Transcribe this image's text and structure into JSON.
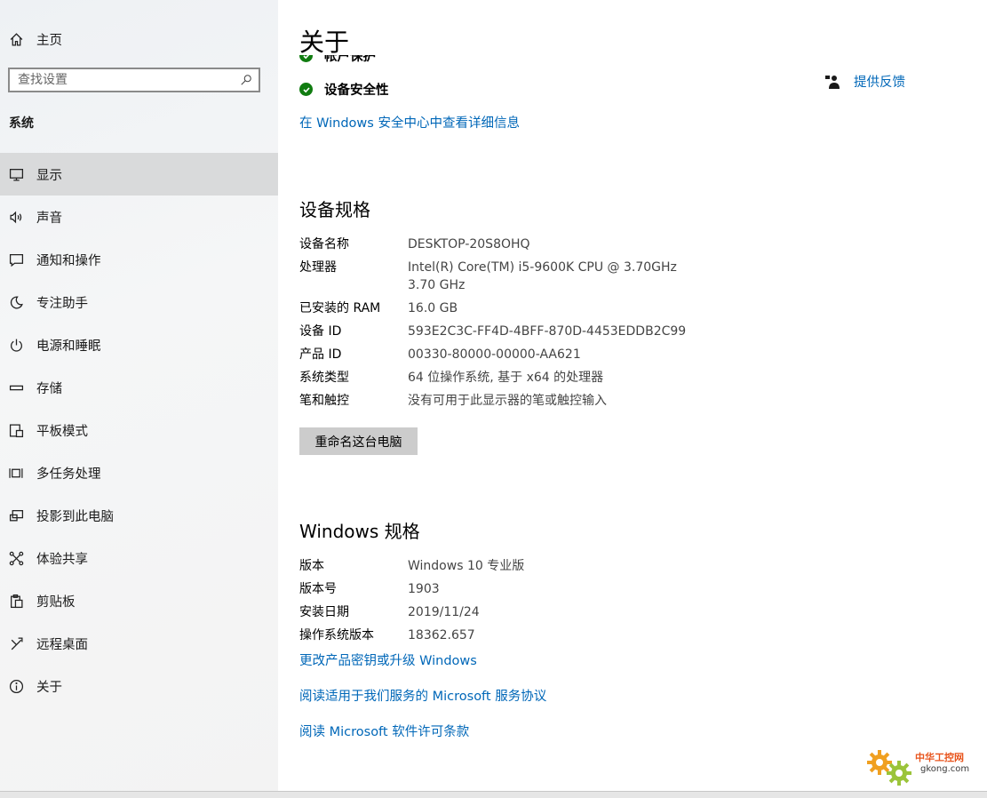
{
  "sidebar": {
    "home_label": "主页",
    "search_placeholder": "查找设置",
    "section_title": "系统",
    "items": [
      {
        "label": "显示",
        "icon": "monitor-icon"
      },
      {
        "label": "声音",
        "icon": "speaker-icon"
      },
      {
        "label": "通知和操作",
        "icon": "message-icon"
      },
      {
        "label": "专注助手",
        "icon": "moon-icon"
      },
      {
        "label": "电源和睡眠",
        "icon": "power-icon"
      },
      {
        "label": "存储",
        "icon": "storage-icon"
      },
      {
        "label": "平板模式",
        "icon": "tablet-icon"
      },
      {
        "label": "多任务处理",
        "icon": "multitask-icon"
      },
      {
        "label": "投影到此电脑",
        "icon": "project-icon"
      },
      {
        "label": "体验共享",
        "icon": "share-icon"
      },
      {
        "label": "剪贴板",
        "icon": "clipboard-icon"
      },
      {
        "label": "远程桌面",
        "icon": "remote-icon"
      },
      {
        "label": "关于",
        "icon": "info-icon"
      }
    ],
    "active_item": "显示"
  },
  "main": {
    "title": "关于",
    "partial_status": "帐户保护",
    "status_item": "设备安全性",
    "security_link": "在 Windows 安全中心中查看详细信息",
    "feedback_label": "提供反馈",
    "device_spec_heading": "设备规格",
    "device_specs": [
      {
        "key": "设备名称",
        "value": "DESKTOP-20S8OHQ"
      },
      {
        "key": "处理器",
        "value": "Intel(R) Core(TM) i5-9600K CPU @ 3.70GHz   3.70 GHz"
      },
      {
        "key": "已安装的 RAM",
        "value": "16.0 GB"
      },
      {
        "key": "设备 ID",
        "value": "593E2C3C-FF4D-4BFF-870D-4453EDDB2C99"
      },
      {
        "key": "产品 ID",
        "value": "00330-80000-00000-AA621"
      },
      {
        "key": "系统类型",
        "value": "64 位操作系统, 基于 x64 的处理器"
      },
      {
        "key": "笔和触控",
        "value": "没有可用于此显示器的笔或触控输入"
      }
    ],
    "rename_button": "重命名这台电脑",
    "windows_spec_heading": "Windows 规格",
    "windows_specs": [
      {
        "key": "版本",
        "value": "Windows 10 专业版"
      },
      {
        "key": "版本号",
        "value": "1903"
      },
      {
        "key": "安装日期",
        "value": "2019/11/24"
      },
      {
        "key": "操作系统版本",
        "value": "18362.657"
      }
    ],
    "links": [
      "更改产品密钥或升级 Windows",
      "阅读适用于我们服务的 Microsoft 服务协议",
      "阅读 Microsoft 软件许可条款"
    ]
  },
  "watermark": {
    "title": "中华工控网",
    "url": "gkong.com"
  },
  "colors": {
    "accent": "#0067b8",
    "check": "#107c10",
    "active_bg": "#d9dadb"
  }
}
